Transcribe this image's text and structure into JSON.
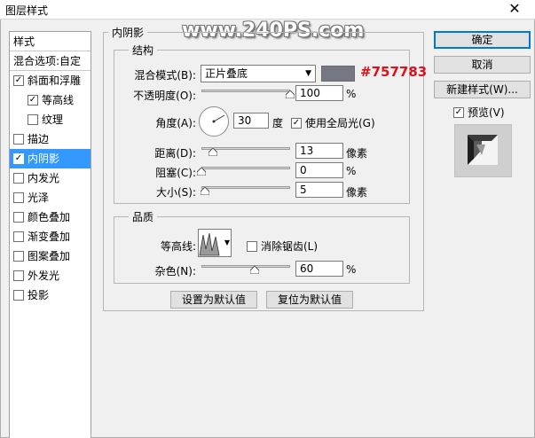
{
  "window": {
    "title": "图层样式",
    "close_glyph": "✕"
  },
  "watermark": "www.240PS.com",
  "left_list": {
    "header": "样式",
    "blend_options": "混合选项:自定",
    "items": [
      {
        "label": "斜面和浮雕",
        "checked": true,
        "indent": false,
        "selected": false
      },
      {
        "label": "等高线",
        "checked": true,
        "indent": true,
        "selected": false
      },
      {
        "label": "纹理",
        "checked": false,
        "indent": true,
        "selected": false
      },
      {
        "label": "描边",
        "checked": false,
        "indent": false,
        "selected": false
      },
      {
        "label": "内阴影",
        "checked": true,
        "indent": false,
        "selected": true
      },
      {
        "label": "内发光",
        "checked": false,
        "indent": false,
        "selected": false
      },
      {
        "label": "光泽",
        "checked": false,
        "indent": false,
        "selected": false
      },
      {
        "label": "颜色叠加",
        "checked": false,
        "indent": false,
        "selected": false
      },
      {
        "label": "渐变叠加",
        "checked": false,
        "indent": false,
        "selected": false
      },
      {
        "label": "图案叠加",
        "checked": false,
        "indent": false,
        "selected": false
      },
      {
        "label": "外发光",
        "checked": false,
        "indent": false,
        "selected": false
      },
      {
        "label": "投影",
        "checked": false,
        "indent": false,
        "selected": false
      }
    ]
  },
  "panel": {
    "title": "内阴影",
    "structure": {
      "title": "结构",
      "blend_mode_label": "混合模式(B):",
      "blend_mode_value": "正片叠底",
      "color_hex": "#757783",
      "color_label": "#757783",
      "opacity_label": "不透明度(O):",
      "opacity_value": "100",
      "opacity_unit": "%",
      "opacity_level": 1.0,
      "angle_label": "角度(A):",
      "angle_value": "30",
      "angle_unit": "度",
      "global_light_label": "使用全局光(G)",
      "global_light_checked": true,
      "distance_label": "距离(D):",
      "distance_value": "13",
      "distance_unit": "像素",
      "distance_level": 0.13,
      "choke_label": "阻塞(C):",
      "choke_value": "0",
      "choke_unit": "%",
      "choke_level": 0.0,
      "size_label": "大小(S):",
      "size_value": "5",
      "size_unit": "像素",
      "size_level": 0.04
    },
    "quality": {
      "title": "品质",
      "contour_label": "等高线:",
      "antialias_label": "消除锯齿(L)",
      "antialias_checked": false,
      "noise_label": "杂色(N):",
      "noise_value": "60",
      "noise_unit": "%",
      "noise_level": 0.6
    },
    "make_default": "设置为默认值",
    "reset_default": "复位为默认值"
  },
  "right": {
    "ok": "确定",
    "cancel": "取消",
    "new_style": "新建样式(W)...",
    "preview_label": "预览(V)",
    "preview_checked": true
  }
}
